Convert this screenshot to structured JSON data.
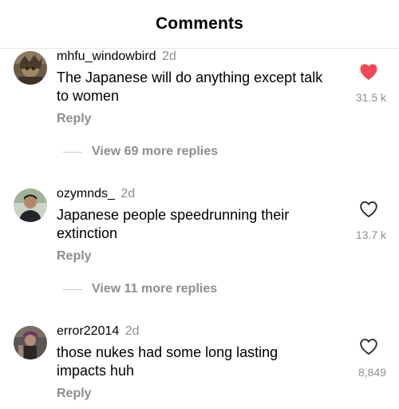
{
  "header": {
    "title": "Comments"
  },
  "comments": [
    {
      "username": "mhfu_windowbird",
      "time": "2d",
      "text": "The Japanese will do anything except talk to women",
      "likes": "31.5 k",
      "liked": true,
      "reply_label": "Reply",
      "more_replies": "View 69 more replies"
    },
    {
      "username": "ozymnds_",
      "time": "2d",
      "text": "Japanese people speedrunning their extinction",
      "likes": "13.7 k",
      "liked": false,
      "reply_label": "Reply",
      "more_replies": "View 11 more replies"
    },
    {
      "username": "error22014",
      "time": "2d",
      "text": "those nukes had some long lasting impacts huh",
      "likes": "8,849",
      "liked": false,
      "reply_label": "Reply"
    }
  ],
  "colors": {
    "liked_heart": "#ed4956",
    "secondary_text": "#8e8e8e",
    "divider": "#e6e6e6"
  },
  "icons": {
    "liked": "heart-filled-icon",
    "unliked": "heart-outline-icon"
  }
}
